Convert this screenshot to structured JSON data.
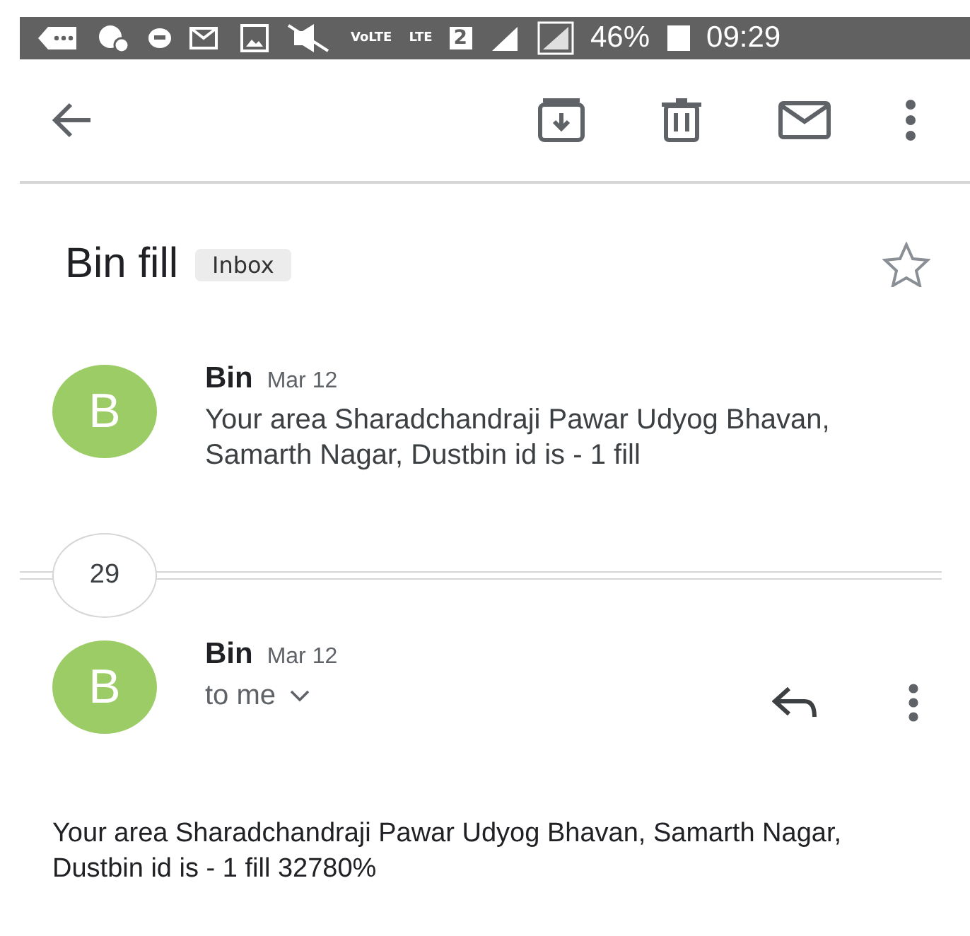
{
  "status_bar": {
    "network_labels": [
      "VoLTE",
      "LTE"
    ],
    "sim": "2",
    "battery": "46%",
    "time": "09:29"
  },
  "subject": {
    "title": "Bin fill",
    "label": "Inbox",
    "starred": false
  },
  "collapsed_message": {
    "avatar": "B",
    "sender": "Bin",
    "date": "Mar 12",
    "snippet": "Your area Sharadchandraji Pawar Udyog Bhavan, Samarth Nagar, Dustbin id is - 1 fill"
  },
  "hidden_count": "29",
  "open_message": {
    "avatar": "B",
    "sender": "Bin",
    "date": "Mar 12",
    "recipient": "to me",
    "body": "Your area Sharadchandraji Pawar Udyog Bhavan, Samarth Nagar, Dustbin id is - 1 fill 32780%"
  }
}
